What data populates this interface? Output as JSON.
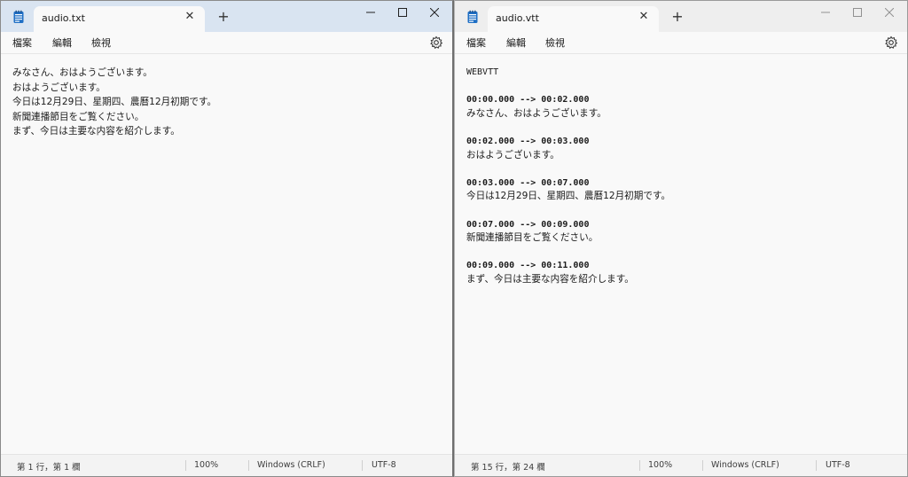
{
  "left_window": {
    "tab_title": "audio.txt",
    "menu": [
      "檔案",
      "編輯",
      "檢視"
    ],
    "lines": [
      "みなさん、おはようございます。",
      "おはようございます。",
      "今日は12月29日、星期四、農曆12月初期です。",
      "新聞連播節目をご覧ください。",
      "まず、今日は主要な内容を紹介します。"
    ],
    "status": {
      "position": "第 1 行，第 1 欄",
      "zoom": "100%",
      "line_ending": "Windows (CRLF)",
      "encoding": "UTF-8"
    }
  },
  "right_window": {
    "tab_title": "audio.vtt",
    "menu": [
      "檔案",
      "編輯",
      "檢視"
    ],
    "header": "WEBVTT",
    "cues": [
      {
        "time": "00:00.000 --> 00:02.000",
        "text": "みなさん、おはようございます。"
      },
      {
        "time": "00:02.000 --> 00:03.000",
        "text": "おはようございます。"
      },
      {
        "time": "00:03.000 --> 00:07.000",
        "text": "今日は12月29日、星期四、農曆12月初期です。"
      },
      {
        "time": "00:07.000 --> 00:09.000",
        "text": "新聞連播節目をご覧ください。"
      },
      {
        "time": "00:09.000 --> 00:11.000",
        "text": "まず、今日は主要な内容を紹介します。"
      }
    ],
    "status": {
      "position": "第 15 行，第 24 欄",
      "zoom": "100%",
      "line_ending": "Windows (CRLF)",
      "encoding": "UTF-8"
    }
  },
  "icons": {
    "app": "notepad-icon",
    "close": "close-icon",
    "new_tab": "plus-icon",
    "settings": "gear-icon",
    "minimize": "minimize-icon",
    "maximize": "maximize-icon",
    "window_close": "window-close-icon"
  },
  "colors": {
    "active_titlebar": "#d9e4f1",
    "inactive_titlebar": "#eeeeee",
    "editor_bg": "#f9f9f9",
    "notepad_icon": "#1f6fc5"
  }
}
